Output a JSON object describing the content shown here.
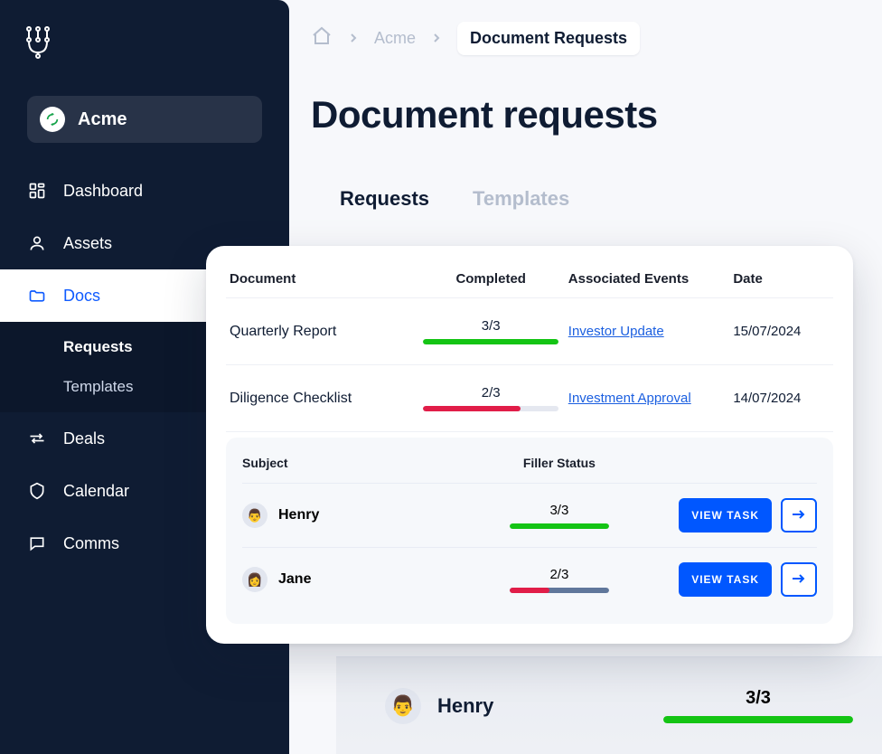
{
  "org": {
    "name": "Acme"
  },
  "sidebar": {
    "items": [
      {
        "label": "Dashboard"
      },
      {
        "label": "Assets"
      },
      {
        "label": "Docs"
      },
      {
        "label": "Deals"
      },
      {
        "label": "Calendar"
      },
      {
        "label": "Comms"
      }
    ],
    "docs_sub": [
      {
        "label": "Requests"
      },
      {
        "label": "Templates"
      }
    ]
  },
  "breadcrumb": {
    "items": [
      {
        "label": "Acme"
      },
      {
        "label": "Document Requests"
      }
    ]
  },
  "page_title": "Document requests",
  "tabs": [
    {
      "label": "Requests"
    },
    {
      "label": "Templates"
    }
  ],
  "table": {
    "columns": [
      "Document",
      "Completed",
      "Associated Events",
      "Date"
    ],
    "rows": [
      {
        "document": "Quarterly Report",
        "completed_label": "3/3",
        "completed_pct": 100,
        "completed_color": "green",
        "associated": "Investor Update",
        "date": "15/07/2024"
      },
      {
        "document": "Diligence Checklist",
        "completed_label": "2/3",
        "completed_pct": 66,
        "completed_color": "red",
        "associated": "Investment Approval",
        "date": "14/07/2024"
      }
    ]
  },
  "sub_table": {
    "columns": [
      "Subject",
      "Filler Status"
    ],
    "rows": [
      {
        "subject": "Henry",
        "avatar_initial": "👨",
        "filler_label": "3/3",
        "filler_pct": 100,
        "filler_color": "green",
        "action_label": "VIEW TASK"
      },
      {
        "subject": "Jane",
        "avatar_initial": "👩",
        "filler_label": "2/3",
        "filler_pct": 66,
        "filler_color": "red_blue",
        "action_label": "VIEW TASK"
      }
    ]
  },
  "bg_row": {
    "subject": "Henry",
    "avatar_initial": "👨",
    "filler_label": "3/3",
    "filler_pct": 100
  }
}
